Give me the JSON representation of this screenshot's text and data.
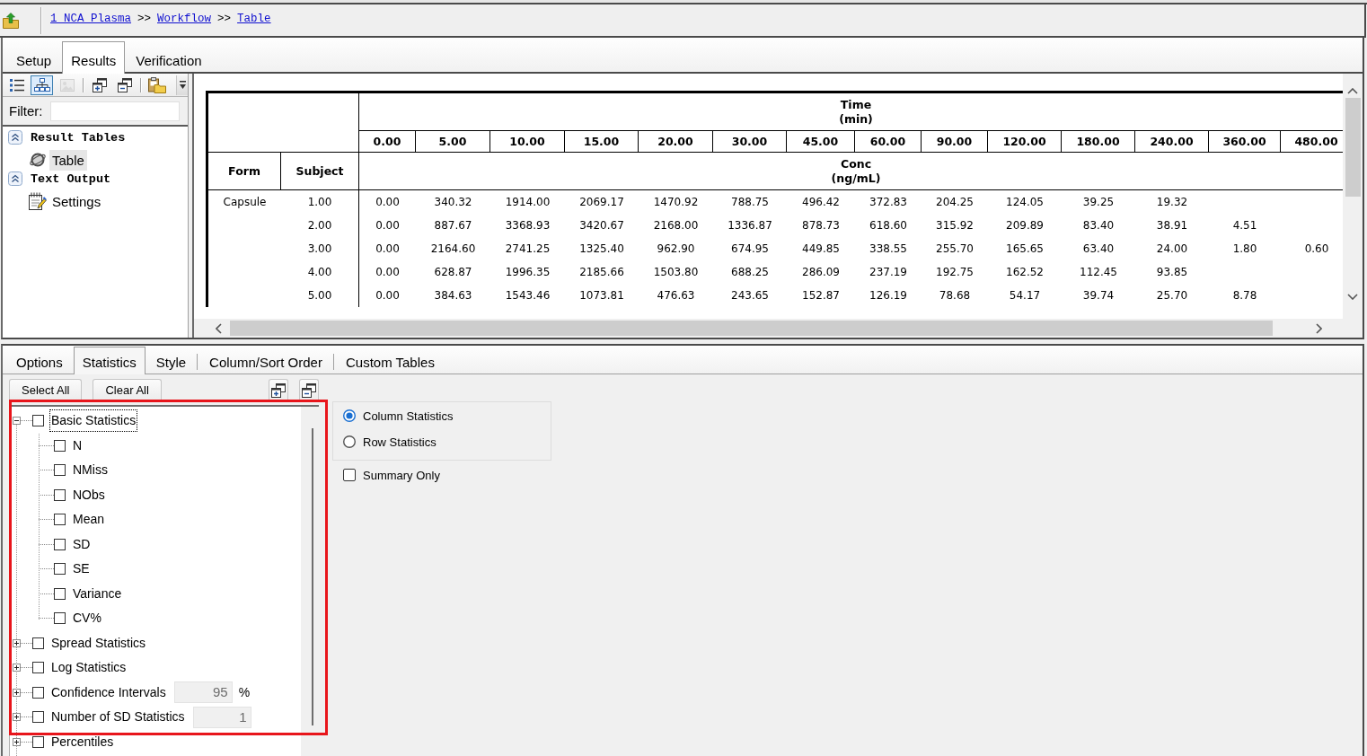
{
  "breadcrumb": [
    {
      "kind": "link",
      "text": "1 NCA Plasma"
    },
    {
      "kind": "separator",
      "text": ">>"
    },
    {
      "kind": "link",
      "text": "Workflow"
    },
    {
      "kind": "separator",
      "text": ">>"
    },
    {
      "kind": "link",
      "text": "Table"
    }
  ],
  "main_tabs": [
    {
      "label": "Setup",
      "selected": false
    },
    {
      "label": "Results",
      "selected": true
    },
    {
      "label": "Verification",
      "selected": false
    }
  ],
  "view_toolbar": [
    {
      "buttons": [
        {
          "kind": "list",
          "selected": false,
          "disabled": false
        },
        {
          "kind": "tree",
          "selected": true,
          "disabled": false
        },
        {
          "kind": "image",
          "selected": false,
          "disabled": true
        }
      ]
    },
    {
      "buttons": [
        {
          "kind": "window-plus",
          "selected": false,
          "disabled": false
        },
        {
          "kind": "window-minus",
          "selected": false,
          "disabled": false
        }
      ]
    },
    {
      "buttons": [
        {
          "kind": "paste",
          "selected": false,
          "disabled": false
        }
      ]
    }
  ],
  "filter": {
    "label": "Filter:"
  },
  "result_tree": [
    {
      "label": "Result Tables",
      "expanded": true,
      "children": [
        {
          "label": "Table",
          "kind": "table",
          "selected": true
        }
      ]
    },
    {
      "label": "Text Output",
      "expanded": true,
      "children": [
        {
          "label": "Settings",
          "kind": "settings",
          "selected": false
        }
      ]
    }
  ],
  "table": {
    "row_headers": [
      "Form",
      "Subject"
    ],
    "time_header": {
      "name": "Time",
      "unit": "(min)"
    },
    "times": [
      "0.00",
      "5.00",
      "10.00",
      "15.00",
      "20.00",
      "30.00",
      "45.00",
      "60.00",
      "90.00",
      "120.00",
      "180.00",
      "240.00",
      "360.00",
      "480.00"
    ],
    "value_header": {
      "name": "Conc",
      "unit": "(ng/mL)"
    },
    "rows": [
      {
        "form": "Capsule",
        "subject": "1.00",
        "values": [
          "0.00",
          "340.32",
          "1914.00",
          "2069.17",
          "1470.92",
          "788.75",
          "496.42",
          "372.83",
          "204.25",
          "124.05",
          "39.25",
          "19.32"
        ]
      },
      {
        "subject": "2.00",
        "values": [
          "0.00",
          "887.67",
          "3368.93",
          "3420.67",
          "2168.00",
          "1336.87",
          "878.73",
          "618.60",
          "315.92",
          "209.89",
          "83.40",
          "38.91",
          "4.51"
        ]
      },
      {
        "subject": "3.00",
        "values": [
          "0.00",
          "2164.60",
          "2741.25",
          "1325.40",
          "962.90",
          "674.95",
          "449.85",
          "338.55",
          "255.70",
          "165.65",
          "63.40",
          "24.00",
          "1.80",
          "0.60"
        ]
      },
      {
        "subject": "4.00",
        "values": [
          "0.00",
          "628.87",
          "1996.35",
          "2185.66",
          "1503.80",
          "688.25",
          "286.09",
          "237.19",
          "192.75",
          "162.52",
          "112.45",
          "93.85"
        ]
      },
      {
        "subject": "5.00",
        "values": [
          "0.00",
          "384.63",
          "1543.46",
          "1073.81",
          "476.63",
          "243.65",
          "152.87",
          "126.19",
          "78.68",
          "54.17",
          "39.74",
          "25.70",
          "8.78"
        ]
      }
    ]
  },
  "options_tabs": [
    {
      "label": "Options",
      "selected": false
    },
    {
      "label": "Statistics",
      "selected": true
    },
    {
      "label": "Style",
      "selected": false
    },
    {
      "label": "Column/Sort Order",
      "selected": false
    },
    {
      "label": "Custom Tables",
      "selected": false
    }
  ],
  "statistics_buttons": [
    {
      "kind": "text",
      "label": "Select All"
    },
    {
      "kind": "text",
      "label": "Clear All"
    },
    {
      "kind": "window-plus"
    },
    {
      "kind": "window-minus"
    }
  ],
  "statistics_tree": [
    {
      "label": "Basic Statistics",
      "checked": false,
      "expanded": true,
      "selected": true,
      "children": [
        {
          "label": "N",
          "checked": false,
          "selected": false
        },
        {
          "label": "NMiss",
          "checked": false,
          "selected": false
        },
        {
          "label": "NObs",
          "checked": false,
          "selected": false
        },
        {
          "label": "Mean",
          "checked": false,
          "selected": false
        },
        {
          "label": "SD",
          "checked": false,
          "selected": false
        },
        {
          "label": "SE",
          "checked": false,
          "selected": false
        },
        {
          "label": "Variance",
          "checked": false,
          "selected": false
        },
        {
          "label": "CV%",
          "checked": false,
          "selected": false
        }
      ]
    },
    {
      "label": "Spread Statistics",
      "checked": false,
      "expanded": false,
      "selected": false
    },
    {
      "label": "Log Statistics",
      "checked": false,
      "expanded": false,
      "selected": false
    },
    {
      "label": "Confidence Intervals",
      "checked": false,
      "expanded": false,
      "selected": false,
      "field": {
        "value": "95",
        "unit": "%",
        "disabled": true
      }
    },
    {
      "label": "Number of SD Statistics",
      "checked": false,
      "expanded": false,
      "selected": false,
      "field": {
        "value": "1",
        "disabled": true
      }
    },
    {
      "label": "Percentiles",
      "checked": false,
      "expanded": false,
      "selected": false
    }
  ],
  "statistics_mode": [
    {
      "label": "Column Statistics",
      "selected": true
    },
    {
      "label": "Row Statistics",
      "selected": false
    }
  ],
  "summary_only": {
    "label": "Summary Only",
    "checked": false
  }
}
